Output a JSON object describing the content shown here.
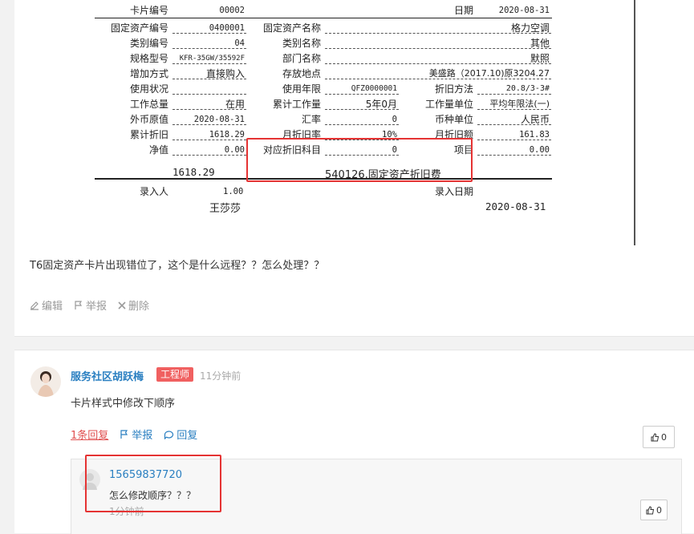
{
  "card": {
    "card_no_label": "卡片编号",
    "card_no": "00002",
    "date_label": "日期",
    "date": "2020-08-31",
    "asset_code_label": "固定资产编号",
    "asset_code": "0400001",
    "asset_name_label": "固定资产名称",
    "asset_name": "格力空调",
    "category_code_label": "类别编号",
    "category_code": "04",
    "category_name_label": "类别名称",
    "category_name": "其他",
    "model_label": "规格型号",
    "model": "KFR-35GW/35592F",
    "dept_label": "部门名称",
    "dept": "默照",
    "add_method_label": "增加方式",
    "add_method": "直接购入",
    "location_label": "存放地点",
    "location": "美盛路（2017.10)原3204.27",
    "usage_label": "使用状况",
    "usage": "",
    "life_label": "使用年限",
    "life": "QFZ0000001",
    "dep_method_label": "折旧方法",
    "dep_method": "20.8/3-3#",
    "workload_label": "工作总量",
    "workload": "在用",
    "acc_workload_label": "累计工作量",
    "acc_workload": "5年0月",
    "work_unit_label": "工作量单位",
    "work_unit": "平均年限法(一)",
    "orig_value_label": "外币原值",
    "orig_value": "2020-08-31",
    "rate_label": "汇率",
    "rate": "0",
    "currency_label": "币种单位",
    "currency": "人民币",
    "acc_dep_label": "累计折旧",
    "acc_dep": "1618.29",
    "month_rate_label": "月折旧率",
    "month_rate": "10%",
    "month_dep_label": "月折旧额",
    "month_dep": "161.83",
    "net_value_label": "净值",
    "net_value": "0.00",
    "dep_subject_label": "对应折旧科目",
    "dep_subject": "0",
    "item_label": "项目",
    "item": "0.00",
    "bottom_left_value": "1618.29",
    "bottom_subject": "540126,固定资产折旧费",
    "entry_person_label": "录入人",
    "entry_person_value": "1.00",
    "entry_person_name": "王莎莎",
    "entry_date_label": "录入日期",
    "entry_date": "2020-08-31"
  },
  "post": {
    "question": "T6固定资产卡片出现错位了，这个是什么远程？？怎么处理？？",
    "edit": "编辑",
    "report": "举报",
    "delete": "删除"
  },
  "comment": {
    "author": "服务社区胡跃梅",
    "badge": "工程师",
    "time": "11分钟前",
    "text": "卡片样式中修改下顺序",
    "reply_count": "1条回复",
    "report": "举报",
    "reply": "回复",
    "likes": "0",
    "reply_item": {
      "name": "15659837720",
      "text": "怎么修改顺序？？？",
      "time": "1分钟前",
      "likes": "0"
    }
  },
  "colors": {
    "accent": "#2a7fc1",
    "badge": "#f06060",
    "highlight": "#e53333"
  }
}
